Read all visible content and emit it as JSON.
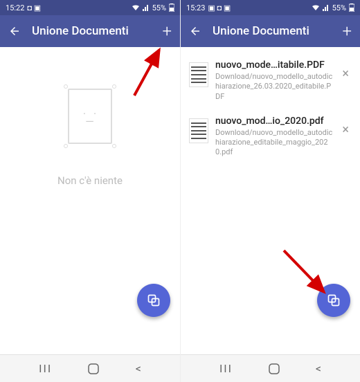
{
  "screens": [
    {
      "status": {
        "time": "15:22",
        "battery": "55%"
      },
      "appbar": {
        "title": "Unione Documenti"
      },
      "empty": {
        "text": "Non c'è niente"
      }
    },
    {
      "status": {
        "time": "15:23",
        "battery": "55%"
      },
      "appbar": {
        "title": "Unione Documenti"
      },
      "files": [
        {
          "name": "nuovo_mode…itabile.PDF",
          "path": "Download/nuovo_modello_autodichiarazione_26.03.2020_editabile.PDF"
        },
        {
          "name": "nuovo_mod…io_2020.pdf",
          "path": "Download/nuovo_modello_autodichiarazione_editabile_maggio_2020.pdf"
        }
      ]
    }
  ],
  "icons": {
    "back": "←",
    "add": "+",
    "close": "×",
    "recent": "|||",
    "home_circle": "○",
    "nav_back": "<"
  }
}
